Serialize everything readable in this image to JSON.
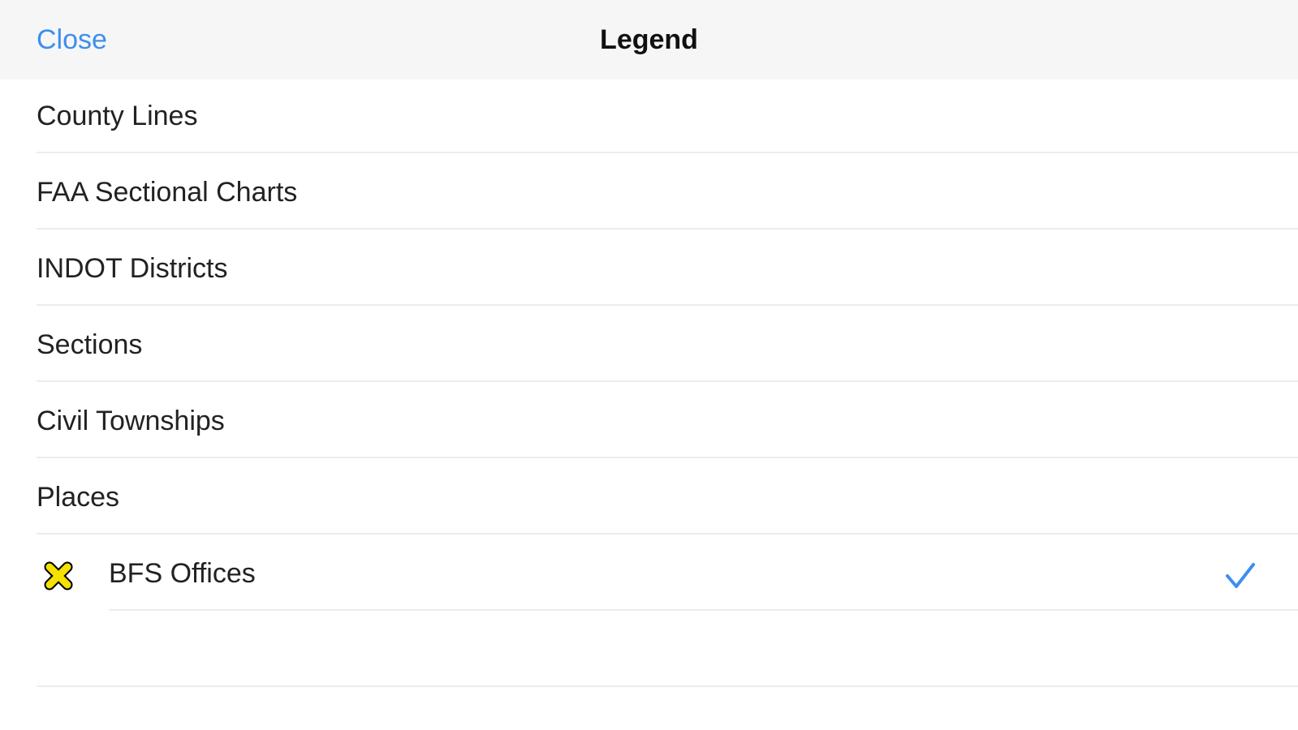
{
  "nav": {
    "close_label": "Close",
    "title": "Legend"
  },
  "layers": [
    {
      "label": "County Lines"
    },
    {
      "label": "FAA Sectional Charts"
    },
    {
      "label": "INDOT Districts"
    },
    {
      "label": "Sections"
    },
    {
      "label": "Civil Townships"
    },
    {
      "label": "Places"
    },
    {
      "label": "BFS Offices",
      "icon": "yellow-x-marker-icon",
      "icon_color": "#f5e200",
      "checked": true
    }
  ],
  "colors": {
    "accent": "#3d8ef0",
    "navbar_bg": "#f6f6f6"
  }
}
